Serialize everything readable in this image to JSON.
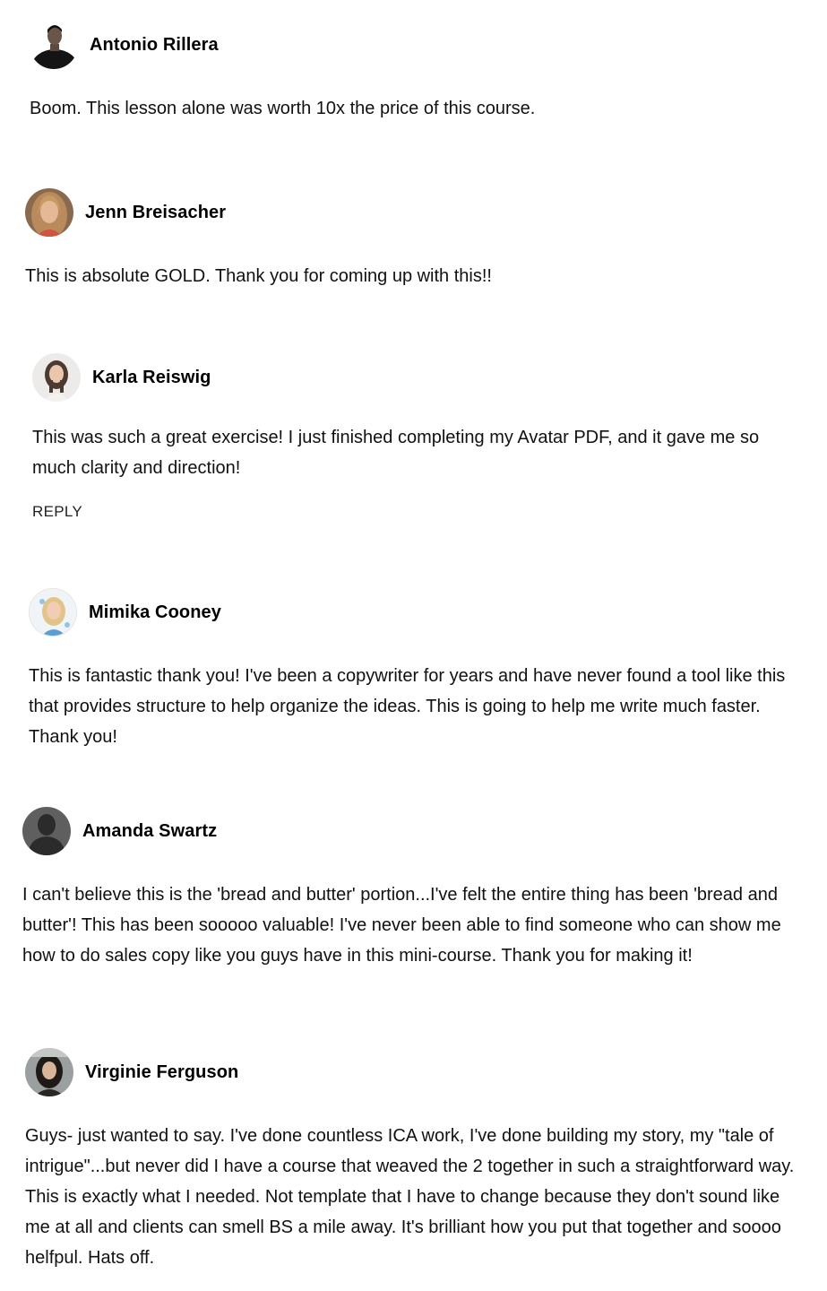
{
  "comments": [
    {
      "author": "Antonio Rillera",
      "avatar": "avatar-photo-man",
      "text": "Boom. This lesson alone was worth 10x the price of this course."
    },
    {
      "author": "Jenn Breisacher",
      "avatar": "avatar-photo-woman",
      "text": "This is absolute GOLD. Thank you for coming up with this!!"
    },
    {
      "author": "Karla Reiswig",
      "avatar": "avatar-photo-woman",
      "text": "This was such a great exercise! I just finished completing my Avatar PDF, and it gave me so much clarity and direction!",
      "reply_label": "REPLY"
    },
    {
      "author": "Mimika Cooney",
      "avatar": "avatar-photo-woman",
      "text": "This is fantastic thank you! I've been a copywriter for years and have never found a tool like this that provides structure to help organize the ideas. This is going to help me write much faster. Thank you!"
    },
    {
      "author": "Amanda Swartz",
      "avatar": "avatar-default-silhouette",
      "text": "I can't believe this is the 'bread and butter' portion...I've felt the entire thing has been 'bread and butter'! This has been sooooo valuable! I've never been able to find someone who can show me how to do sales copy like you guys have in this mini-course. Thank you for making it!"
    },
    {
      "author": "Virginie Ferguson",
      "avatar": "avatar-photo-woman",
      "text": "Guys- just wanted to say. I've done countless ICA work, I've done building my story, my \"tale of intrigue\"...but never did I have a course that weaved the 2 together in such a straightforward way. This is exactly what I needed. Not template that I have to change because they don't sound like me at all and clients can smell BS a mile away. It's brilliant how you put that together and soooo helfpul. Hats off."
    }
  ],
  "colors": {
    "text": "#111111",
    "background": "#ffffff",
    "silhouette_bg": "#5f5f5f",
    "silhouette_fg": "#2b2b2b"
  }
}
